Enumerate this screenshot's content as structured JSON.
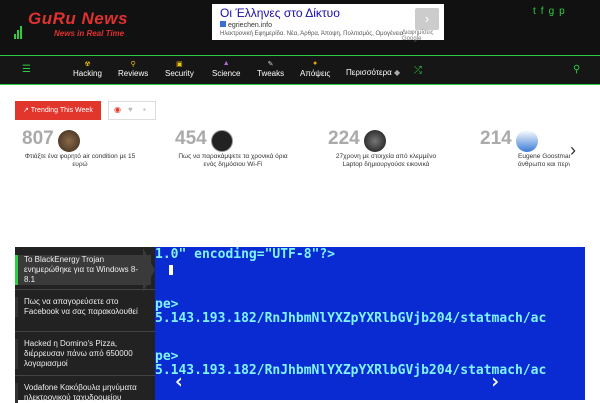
{
  "header": {
    "logo_text": "GuRu News",
    "logo_tagline": "News in Real Time",
    "ad": {
      "title": "Οι Έλληνες στο Δίκτυο",
      "url": "egriechen.info",
      "description": "Ηλεκτρονική Εφημερίδα. Νέα, Άρθρα, Άποψη, Πολιτισμός, Ομογένεια",
      "note": "Διαφημίσεις Google"
    },
    "social_icons": [
      "twitter-icon",
      "facebook-icon",
      "google-plus-icon",
      "pinterest-icon"
    ]
  },
  "nav": {
    "items": [
      {
        "label": "Hacking",
        "icon": "radioactive-icon"
      },
      {
        "label": "Reviews",
        "icon": "magnifier-icon"
      },
      {
        "label": "Security",
        "icon": "lock-icon"
      },
      {
        "label": "Science",
        "icon": "flask-icon"
      },
      {
        "label": "Tweaks",
        "icon": "wrench-icon"
      },
      {
        "label": "Απόψεις",
        "icon": "circle-icon"
      }
    ],
    "more_label": "Περισσότερα"
  },
  "trending": {
    "tab_label": "Trending This Week",
    "cards": [
      {
        "count": "807",
        "title": "Φτιάξτε ένα φορητό air condition με 15 ευρώ"
      },
      {
        "count": "454",
        "title": "Πως να παρακάμψετε τα χρονικά όρια ενός δημόσιου Wi-Fi"
      },
      {
        "count": "224",
        "title": "27χρονη με στοιχεία από κλεμμένο Laptop δημιουργούσε εικονικά"
      },
      {
        "count": "214",
        "title": "Eugene Goostman: Ξεγελάει άνθρωπο και περνάει το Turing τεστ"
      }
    ]
  },
  "sidebar": {
    "items": [
      "Το BlackEnergy Trojan ενημερώθηκε για τα Windows 8-8.1",
      "Πως να απαγορεύσετε στο Facebook να σας παρακολουθεί",
      "Hacked η Domino's Pizza, διέρρευσαν πάνω από 650000 λογαριασμοί",
      "Vodafone Κακόβουλα μηνύματα ηλεκτρονικού ταχυδρομείου"
    ]
  },
  "slider": {
    "code_lines": [
      "1.0\" encoding=\"UTF-8\"?>",
      "pe>",
      "5.143.193.182/RnJhbmNlYXZpYXRlbGVjb204/statmach/ac",
      "pe>",
      "5.143.193.182/RnJhbmNlYXZpYXRlbGVjb204/statmach/ac"
    ]
  }
}
